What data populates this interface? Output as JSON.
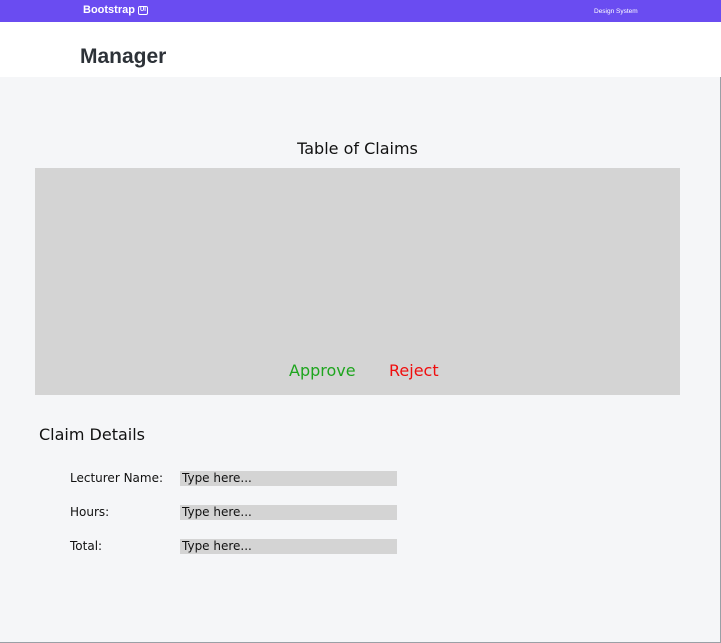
{
  "navbar": {
    "brand": "Bootstrap",
    "brand_badge": "UI",
    "link": "Design System"
  },
  "header": {
    "title": "Manager"
  },
  "claims": {
    "title": "Table of Claims",
    "approve_label": "Approve",
    "reject_label": "Reject"
  },
  "details": {
    "title": "Claim Details",
    "fields": [
      {
        "label": "Lecturer Name:",
        "value": "",
        "placeholder": "Type here..."
      },
      {
        "label": "Hours:",
        "value": "",
        "placeholder": "Type here..."
      },
      {
        "label": "Total:",
        "value": "",
        "placeholder": "Type here..."
      }
    ]
  },
  "colors": {
    "navbar": "#6a4cf1",
    "approve": "#1ea51e",
    "reject": "#f00d0d",
    "panel": "#d4d4d4",
    "background": "#f5f6f8"
  }
}
